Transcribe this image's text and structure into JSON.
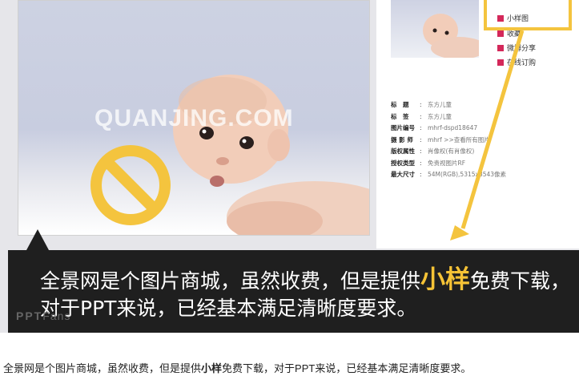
{
  "photo": {
    "watermark": "QUANJING.COM"
  },
  "actions": {
    "items": [
      "小样图",
      "收藏",
      "微博分享",
      "在线订购"
    ]
  },
  "meta": {
    "rows": [
      {
        "key": "标　题",
        "value": "东方儿童"
      },
      {
        "key": "标　签",
        "value": "东方儿童"
      },
      {
        "key": "图片编号",
        "value": "mhrf-dspd18647"
      },
      {
        "key": "摄 影 师",
        "value": "mhrf >>查看所有图片"
      },
      {
        "key": "版权属性",
        "value": "肖像权(有肖像权)"
      },
      {
        "key": "授权类型",
        "value": "免责视图片RF"
      },
      {
        "key": "最大尺寸",
        "value": "54M(RGB),5315x3543像素"
      }
    ]
  },
  "caption": {
    "line1_pre": "全景网是个图片商城，虽然收费，但是提供",
    "line1_highlight": "小样",
    "line1_post": "免费下载，",
    "line2": "对于PPT来说，已经基本满足清晰度要求。",
    "brand_left": "PPT",
    "brand_right": "Fans"
  },
  "footer": {
    "pre": "全景网是个图片商城，虽然收费，但是提供",
    "bold": "小样",
    "post": "免费下载，对于PPT来说，已经基本满足清晰度要求。"
  },
  "colors": {
    "accent_yellow": "#f4c43e",
    "action_red": "#d4285a",
    "caption_bg": "#1f1f1f"
  }
}
